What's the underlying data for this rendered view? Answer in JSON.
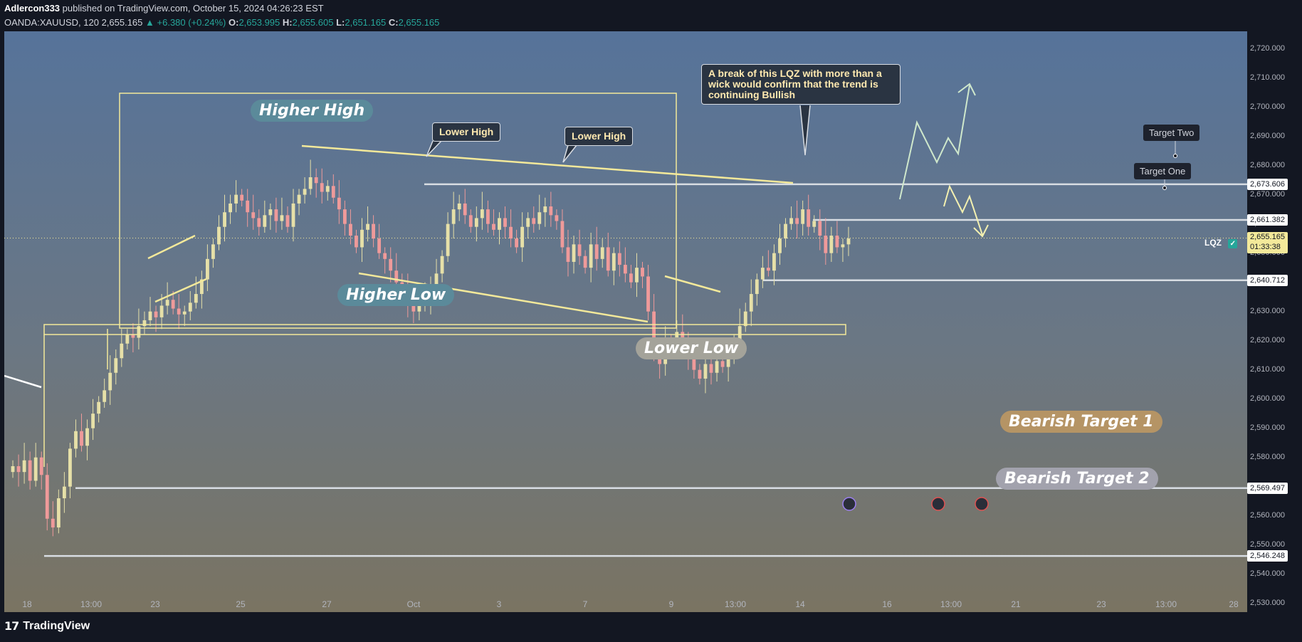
{
  "header": {
    "author": "Adlercon333",
    "published_text": "published on TradingView.com, October 15, 2024 04:26:23 EST",
    "symbol": "OANDA:XAUUSD, 120",
    "price": "2,655.165",
    "change": "▲ +6.380 (+0.24%)",
    "o_label": "O:",
    "o_value": "2,653.995",
    "h_label": "H:",
    "h_value": "2,655.605",
    "l_label": "L:",
    "l_value": "2,651.165",
    "c_label": "C:",
    "c_value": "2,655.165"
  },
  "chart_data": {
    "type": "candlestick",
    "y_axis": {
      "ticks": [
        "2,720.000",
        "2,710.000",
        "2,700.000",
        "2,690.000",
        "2,680.000",
        "2,670.000",
        "2,660.000",
        "2,650.000",
        "2,640.000",
        "2,630.000",
        "2,620.000",
        "2,610.000",
        "2,600.000",
        "2,590.000",
        "2,580.000",
        "2,570.000",
        "2,560.000",
        "2,550.000",
        "2,540.000",
        "2,530.000"
      ],
      "tick_values": [
        2720,
        2710,
        2700,
        2690,
        2680,
        2670,
        2660,
        2650,
        2640,
        2630,
        2620,
        2610,
        2600,
        2590,
        2580,
        2570,
        2560,
        2550,
        2540,
        2530
      ],
      "range": [
        2527,
        2726
      ]
    },
    "x_axis": {
      "ticks": [
        "18",
        "13:00",
        "23",
        "25",
        "27",
        "Oct",
        "3",
        "7",
        "9",
        "13:00",
        "14",
        "16",
        "13:00",
        "21",
        "23",
        "13:00",
        "28"
      ]
    },
    "price_levels": [
      {
        "label": "2,673.606",
        "value": 2673.606
      },
      {
        "label": "2,661.382",
        "value": 2661.382
      },
      {
        "label": "2,655.165",
        "value": 2655.165,
        "sub": "01:33:38",
        "current": true
      },
      {
        "label": "2,640.712",
        "value": 2640.712
      },
      {
        "label": "2,569.497",
        "value": 2569.497
      },
      {
        "label": "2,546.248",
        "value": 2546.248
      }
    ],
    "annotations": {
      "higher_high": "Higher High",
      "higher_low": "Higher Low",
      "lower_high_1": "Lower High",
      "lower_high_2": "Lower High",
      "lower_low": "Lower Low",
      "callout_lqz": "A break of this LQZ with more than a wick would confirm that the trend is continuing Bullish",
      "target_two": "Target Two",
      "target_one": "Target One",
      "lqz": "LQZ",
      "bearish_1": "Bearish Target 1",
      "bearish_2": "Bearish Target 2"
    },
    "candles_close": [
      2577,
      2575,
      2579,
      2572,
      2580,
      2574,
      2559,
      2556,
      2566,
      2570,
      2583,
      2589,
      2584,
      2590,
      2595,
      2599,
      2603,
      2609,
      2614,
      2619,
      2622,
      2621,
      2625,
      2627,
      2630,
      2628,
      2632,
      2634,
      2631,
      2629,
      2630,
      2633,
      2636,
      2641,
      2648,
      2653,
      2659,
      2664,
      2667,
      2670,
      2668,
      2664,
      2662,
      2659,
      2663,
      2665,
      2661,
      2663,
      2659,
      2667,
      2670,
      2672,
      2676,
      2674,
      2671,
      2673,
      2669,
      2665,
      2660,
      2656,
      2652,
      2658,
      2660,
      2655,
      2650,
      2648,
      2644,
      2640,
      2638,
      2633,
      2630,
      2632,
      2634,
      2639,
      2643,
      2649,
      2660,
      2665,
      2667,
      2663,
      2659,
      2662,
      2665,
      2660,
      2658,
      2662,
      2659,
      2655,
      2652,
      2659,
      2662,
      2660,
      2664,
      2666,
      2663,
      2661,
      2652,
      2647,
      2653,
      2649,
      2645,
      2653,
      2648,
      2652,
      2644,
      2650,
      2646,
      2643,
      2640,
      2645,
      2642,
      2630,
      2615,
      2612,
      2620,
      2618,
      2623,
      2620,
      2614,
      2610,
      2607,
      2612,
      2609,
      2613,
      2611,
      2616,
      2618,
      2625,
      2630,
      2636,
      2641,
      2645,
      2644,
      2650,
      2655,
      2660,
      2662,
      2660,
      2665,
      2659,
      2661,
      2656,
      2650,
      2656,
      2652,
      2653,
      2655
    ],
    "legend": "none",
    "grid": false
  },
  "footer": {
    "brand": "TradingView"
  },
  "colors": {
    "bull": "#e6e0a8",
    "bear": "#ef9a9a",
    "level_line": "#d8dde3",
    "yellow": "#f3e99a",
    "pill_blue": "#5b8a9a",
    "pill_gray": "#a4a39a",
    "pill_gold": "#b59465",
    "pill_silver": "#a2a2ad"
  }
}
